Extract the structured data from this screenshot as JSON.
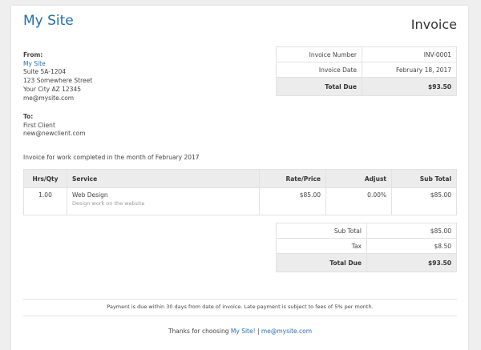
{
  "header": {
    "site_name": "My Site",
    "doc_title": "Invoice"
  },
  "from": {
    "label": "From:",
    "name": "My Site",
    "lines": [
      "Suite 5A-1204",
      "123 Somewhere Street",
      "Your City AZ 12345",
      "me@mysite.com"
    ]
  },
  "to": {
    "label": "To:",
    "lines": [
      "First Client",
      "new@newclient.com"
    ]
  },
  "info": {
    "rows": [
      {
        "label": "Invoice Number",
        "value": "INV-0001"
      },
      {
        "label": "Invoice Date",
        "value": "February 18, 2017"
      }
    ],
    "total_label": "Total Due",
    "total_value": "$93.50"
  },
  "description": "Invoice for work completed in the month of February 2017",
  "items": {
    "headers": [
      "Hrs/Qty",
      "Service",
      "Rate/Price",
      "Adjust",
      "Sub Total"
    ],
    "rows": [
      {
        "qty": "1.00",
        "service": "Web Design",
        "detail": "Design work on the website",
        "rate": "$85.00",
        "adjust": "0.00%",
        "subtotal": "$85.00"
      }
    ]
  },
  "totals": {
    "rows": [
      {
        "label": "Sub Total",
        "value": "$85.00"
      },
      {
        "label": "Tax",
        "value": "$8.50"
      }
    ],
    "total_label": "Total Due",
    "total_value": "$93.50"
  },
  "footer": {
    "terms": "Payment is due within 30 days from date of invoice. Late payment is subject to fees of 5% per month.",
    "thanks": "Thanks for choosing",
    "site_link": "My Site!",
    "separator": "|",
    "email": "me@mysite.com"
  }
}
